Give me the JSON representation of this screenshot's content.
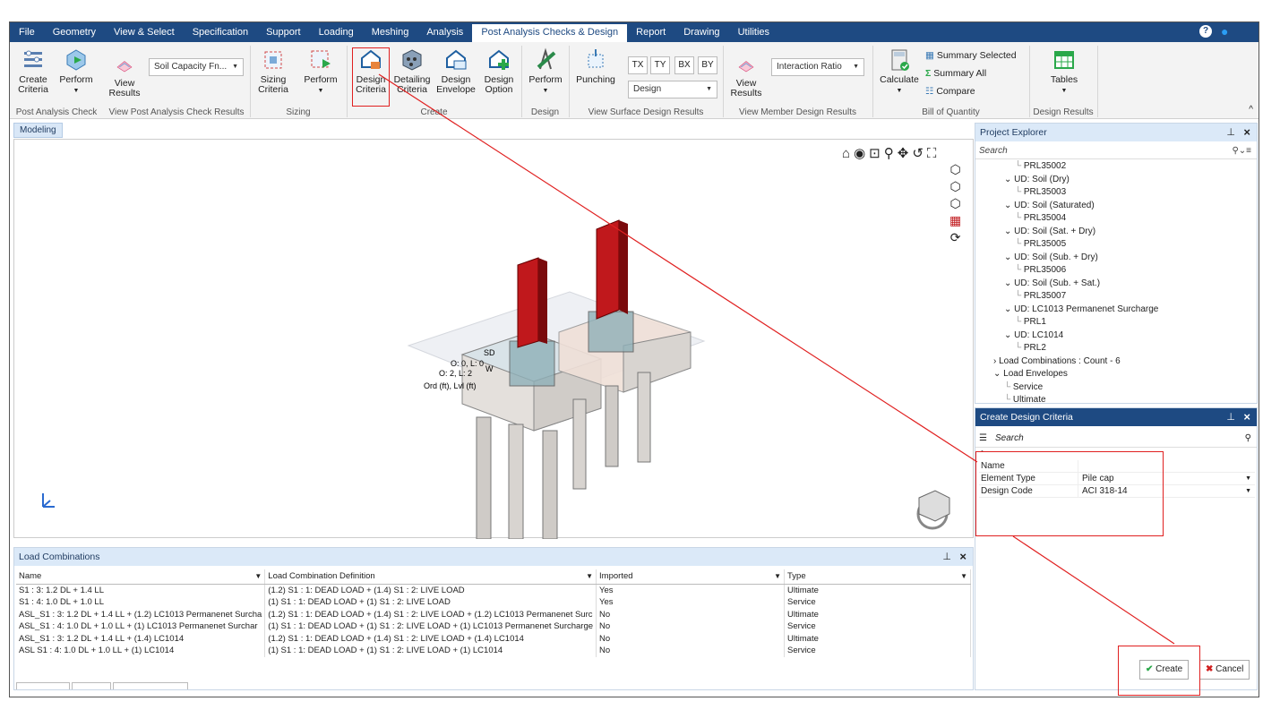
{
  "menu": {
    "tabs": [
      "File",
      "Geometry",
      "View & Select",
      "Specification",
      "Support",
      "Loading",
      "Meshing",
      "Analysis",
      "Post Analysis Checks & Design",
      "Report",
      "Drawing",
      "Utilities"
    ],
    "active_index": 8
  },
  "ribbon": {
    "create_criteria": "Create\nCriteria",
    "perform1": "Perform",
    "view_results1": "View\nResults",
    "soil_dropdown": "Soil Capacity Fn...",
    "sizing_criteria": "Sizing\nCriteria",
    "perform2": "Perform",
    "design_criteria": "Design\nCriteria",
    "detailing_criteria": "Detailing\nCriteria",
    "design_envelope": "Design\nEnvelope",
    "design_option": "Design\nOption",
    "perform3": "Perform",
    "punching": "Punching",
    "tx": "TX",
    "ty": "TY",
    "bx": "BX",
    "by": "BY",
    "design_dropdown": "Design",
    "view_results2": "View\nResults",
    "interaction_dropdown": "Interaction Ratio",
    "calculate": "Calculate",
    "summary_selected": "Summary Selected",
    "summary_all": "Summary All",
    "compare": "Compare",
    "tables": "Tables",
    "groups": [
      "Post Analysis Check",
      "View Post Analysis Check Results",
      "Sizing",
      "Create",
      "Design",
      "View Surface Design Results",
      "View Member Design Results",
      "Bill of Quantity",
      "Design Results"
    ]
  },
  "modeling_tab": "Modeling",
  "viewport_labels": [
    "O: 0, L: 0",
    "O:  2, L:  2",
    "Ord (ft), Lvl (ft)",
    "SD",
    "W"
  ],
  "project_explorer": {
    "title": "Project Explorer",
    "search": "Search",
    "tree": [
      {
        "label": "PRL35002",
        "indent": 4
      },
      {
        "label": "UD: Soil (Dry)",
        "indent": 3,
        "exp": "v"
      },
      {
        "label": "PRL35003",
        "indent": 4
      },
      {
        "label": "UD: Soil (Saturated)",
        "indent": 3,
        "exp": "v"
      },
      {
        "label": "PRL35004",
        "indent": 4
      },
      {
        "label": "UD: Soil (Sat. + Dry)",
        "indent": 3,
        "exp": "v"
      },
      {
        "label": "PRL35005",
        "indent": 4
      },
      {
        "label": "UD: Soil (Sub. + Dry)",
        "indent": 3,
        "exp": "v"
      },
      {
        "label": "PRL35006",
        "indent": 4
      },
      {
        "label": "UD: Soil (Sub. + Sat.)",
        "indent": 3,
        "exp": "v"
      },
      {
        "label": "PRL35007",
        "indent": 4
      },
      {
        "label": "UD: LC1013 Permanenet Surcharge",
        "indent": 3,
        "exp": "v"
      },
      {
        "label": "PRL1",
        "indent": 4
      },
      {
        "label": "UD: LC1014",
        "indent": 3,
        "exp": "v"
      },
      {
        "label": "PRL2",
        "indent": 4
      },
      {
        "label": "Load Combinations : Count - 6",
        "indent": 2,
        "exp": ">"
      },
      {
        "label": "Load Envelopes",
        "indent": 2,
        "exp": "v"
      },
      {
        "label": "Service",
        "indent": 3
      },
      {
        "label": "Ultimate",
        "indent": 3
      }
    ]
  },
  "create_design_criteria": {
    "title": "Create Design Criteria",
    "search": "Search",
    "rows": [
      {
        "k": "Name",
        "v": ""
      },
      {
        "k": "Element Type",
        "v": "Pile cap"
      },
      {
        "k": "Design Code",
        "v": "ACI 318-14"
      }
    ],
    "create": "Create",
    "cancel": "Cancel"
  },
  "load_combinations": {
    "title": "Load Combinations",
    "columns": [
      "Name",
      "Load Combination Definition",
      "Imported",
      "Type"
    ],
    "rows": [
      [
        "S1 : 3: 1.2 DL + 1.4 LL",
        "(1.2) S1 : 1: DEAD LOAD + (1.4) S1 : 2: LIVE LOAD",
        "Yes",
        "Ultimate"
      ],
      [
        "S1 : 4: 1.0 DL + 1.0 LL",
        "(1) S1 : 1: DEAD LOAD + (1) S1 : 2: LIVE LOAD",
        "Yes",
        "Service"
      ],
      [
        "ASL_S1 : 3: 1.2 DL + 1.4 LL + (1.2) LC1013 Permanenet Surcha",
        "(1.2) S1 : 1: DEAD LOAD + (1.4) S1 : 2: LIVE LOAD + (1.2) LC1013 Permanenet Surc",
        "No",
        "Ultimate"
      ],
      [
        "ASL_S1 : 4: 1.0 DL + 1.0 LL + (1) LC1013 Permanenet Surchar",
        "(1) S1 : 1: DEAD LOAD + (1) S1 : 2: LIVE LOAD + (1) LC1013 Permanenet Surcharge",
        "No",
        "Service"
      ],
      [
        "ASL_S1 : 3: 1.2 DL + 1.4 LL + (1.4) LC1014",
        "(1.2) S1 : 1: DEAD LOAD + (1.4) S1 : 2: LIVE LOAD + (1.4) LC1014",
        "No",
        "Ultimate"
      ],
      [
        "ASL S1 : 4: 1.0 DL + 1.0 LL + (1) LC1014",
        "(1) S1 : 1: DEAD LOAD + (1) S1 : 2: LIVE LOAD + (1) LC1014",
        "No",
        "Service"
      ]
    ]
  },
  "colors": {
    "accent": "#1e4a82",
    "annotation": "#e02020",
    "column_red": "#c0181c"
  }
}
